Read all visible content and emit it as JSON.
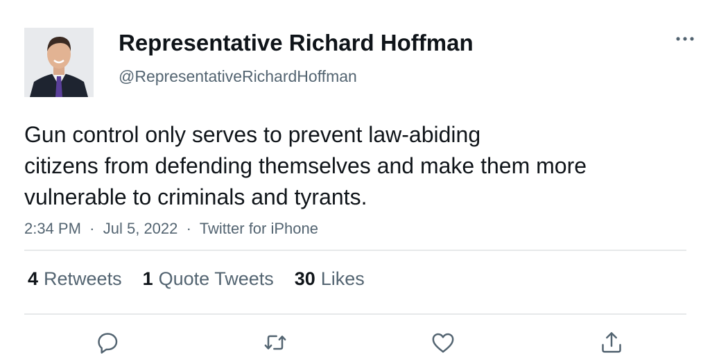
{
  "author": {
    "display_name": "Representative Richard Hoffman",
    "handle": "@RepresentativeRichardHoffman"
  },
  "tweet": {
    "text_lines": [
      "Gun control only serves to prevent law-abiding",
      "citizens from defending themselves and make them more",
      "vulnerable to criminals and tyrants."
    ],
    "time": "2:34 PM",
    "date": "Jul 5, 2022",
    "source": "Twitter for iPhone",
    "separator": "·"
  },
  "stats": {
    "retweets_count": "4",
    "retweets_label": "Retweets",
    "quote_tweets_count": "1",
    "quote_tweets_label": "Quote Tweets",
    "likes_count": "30",
    "likes_label": "Likes"
  },
  "colors": {
    "text_primary": "#0f1419",
    "text_secondary": "#536471",
    "divider": "#e6e8ea",
    "icon": "#536471"
  },
  "icons": {
    "more": "more-dots-icon",
    "reply": "reply-icon",
    "retweet": "retweet-icon",
    "like": "heart-icon",
    "share": "share-icon"
  }
}
